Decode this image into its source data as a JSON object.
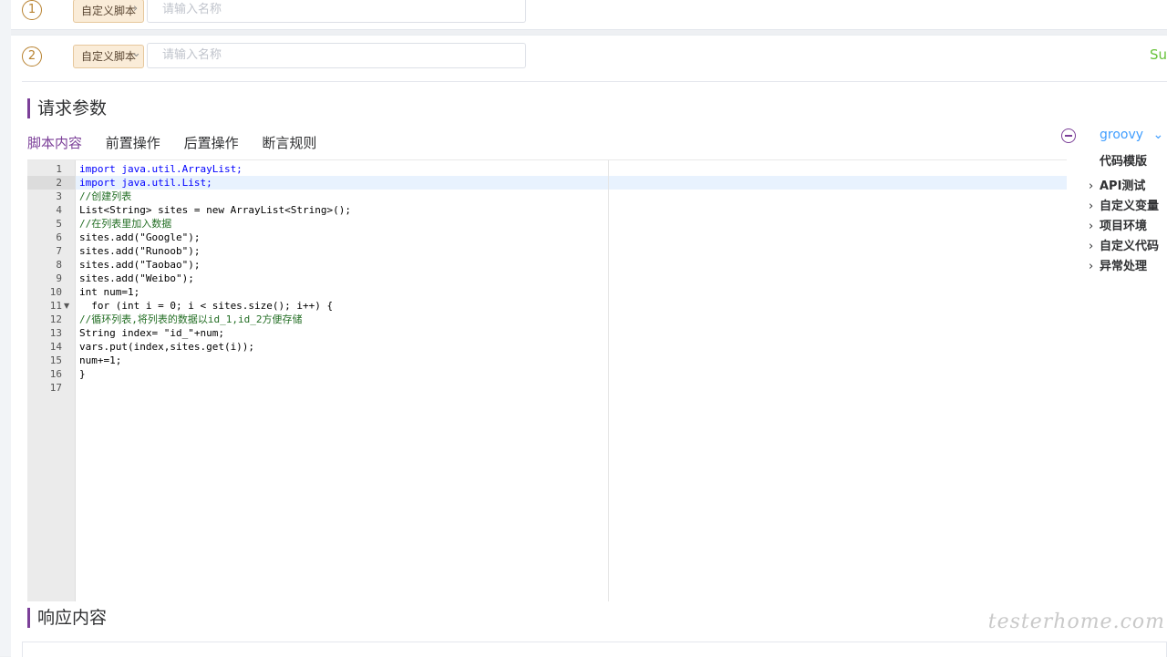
{
  "step1": {
    "number": "1",
    "tag": "自定义脚本",
    "chevron": "›",
    "placeholder": "请输入名称"
  },
  "step2": {
    "number": "2",
    "tag": "自定义脚本",
    "chevron": "⌄",
    "placeholder": "请输入名称",
    "status": "Su"
  },
  "sections": {
    "request_params": "请求参数",
    "response": "响应内容"
  },
  "tabs": [
    "脚本内容",
    "前置操作",
    "后置操作",
    "断言规则"
  ],
  "editor": {
    "line_numbers": [
      "1",
      "2",
      "3",
      "4",
      "5",
      "6",
      "7",
      "8",
      "9",
      "10",
      "11",
      "12",
      "13",
      "14",
      "15",
      "16",
      "17"
    ],
    "lines": [
      "import java.util.ArrayList;",
      "import java.util.List;",
      "//创建列表",
      "List<String> sites = new ArrayList<String>();",
      "//在列表里加入数据",
      "sites.add(\"Google\");",
      "sites.add(\"Runoob\");",
      "sites.add(\"Taobao\");",
      "sites.add(\"Weibo\");",
      "int num=1;",
      "  for (int i = 0; i < sites.size(); i++) {",
      "//循环列表,将列表的数据以id_1,id_2方便存储",
      "String index= \"id_\"+num;",
      "vars.put(index,sites.get(i));",
      "num+=1;",
      "}",
      ""
    ]
  },
  "sidepanel": {
    "language": "groovy",
    "language_chevron": "⌄",
    "template_title": "代码模版",
    "tree": [
      "API测试",
      "自定义变量",
      "项目环境",
      "自定义代码",
      "异常处理"
    ]
  },
  "watermark": "testerhome.com"
}
